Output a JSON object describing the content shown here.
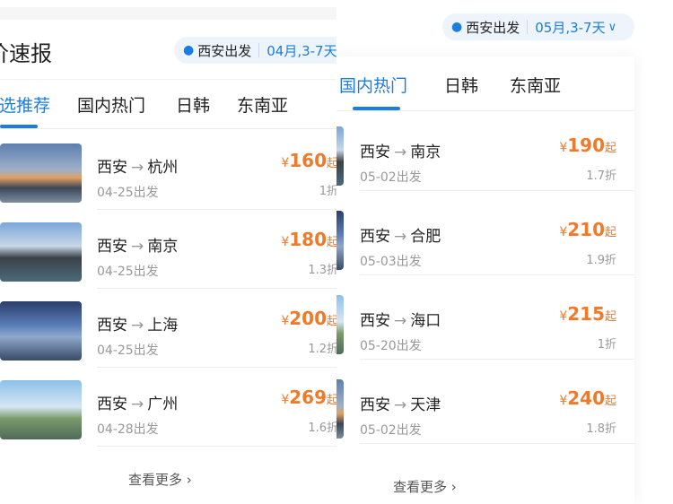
{
  "left": {
    "title": "价速报",
    "departure": "西安出发",
    "date_filter": "04月,3-7天",
    "tabs": [
      "精选推荐",
      "国内热门",
      "日韩",
      "东南亚"
    ],
    "active_tab": 0,
    "deals": [
      {
        "from": "西安",
        "to": "杭州",
        "date": "04-25出发",
        "price": "160",
        "discount": "1折"
      },
      {
        "from": "西安",
        "to": "南京",
        "date": "04-25出发",
        "price": "180",
        "discount": "1.3折"
      },
      {
        "from": "西安",
        "to": "上海",
        "date": "04-25出发",
        "price": "200",
        "discount": "1.2折"
      },
      {
        "from": "西安",
        "to": "广州",
        "date": "04-28出发",
        "price": "269",
        "discount": "1.6折"
      }
    ],
    "more_label": "查看更多"
  },
  "right": {
    "departure": "西安出发",
    "date_filter": "05月,3-7天",
    "tabs": [
      "国内热门",
      "日韩",
      "东南亚"
    ],
    "active_tab": 0,
    "deals": [
      {
        "from": "西安",
        "to": "南京",
        "date": "05-02出发",
        "price": "190",
        "discount": "1.7折"
      },
      {
        "from": "西安",
        "to": "合肥",
        "date": "05-03出发",
        "price": "210",
        "discount": "1.9折"
      },
      {
        "from": "西安",
        "to": "海口",
        "date": "05-20出发",
        "price": "215",
        "discount": "1折"
      },
      {
        "from": "西安",
        "to": "天津",
        "date": "05-02出发",
        "price": "240",
        "discount": "1.8折"
      }
    ],
    "more_label": "查看更多"
  },
  "common": {
    "currency": "¥",
    "suffix": "起",
    "arrow": "→",
    "chevron": "›"
  },
  "colors": {
    "accent": "#1a7de0",
    "price": "#f07a2a"
  }
}
